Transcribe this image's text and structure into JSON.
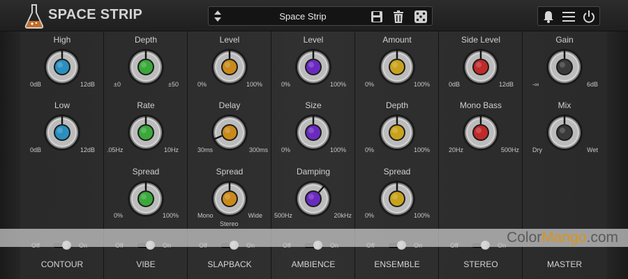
{
  "header": {
    "title": "SPACE STRIP",
    "preset_name": "Space Strip",
    "icons": [
      "flask-logo-icon",
      "up-down-arrows-icon",
      "save-icon",
      "trash-icon",
      "dice-icon",
      "bell-icon",
      "menu-icon",
      "power-icon"
    ]
  },
  "colors": {
    "blue": "#2a8fc0",
    "green": "#3aa83a",
    "orange": "#c98a1a",
    "purple": "#6a2ac0",
    "yellow": "#c8a21a",
    "red": "#c02a2a",
    "gray": "#3a3a3a"
  },
  "columns": [
    {
      "name": "CONTOUR",
      "toggle": {
        "off": "Off",
        "on": "On",
        "value": "on"
      },
      "knobs": [
        {
          "label": "High",
          "min": "0dB",
          "max": "12dB",
          "color": "blue",
          "value": 0.5
        },
        {
          "label": "Low",
          "min": "0dB",
          "max": "12dB",
          "color": "blue",
          "value": 0.5
        }
      ]
    },
    {
      "name": "VIBE",
      "toggle": {
        "off": "Off",
        "on": "On",
        "value": "on"
      },
      "knobs": [
        {
          "label": "Depth",
          "min": "±0",
          "max": "±50",
          "color": "green",
          "value": 0.5
        },
        {
          "label": "Rate",
          "min": ".05Hz",
          "max": "10Hz",
          "color": "green",
          "value": 0.5
        },
        {
          "label": "Spread",
          "min": "0%",
          "max": "100%",
          "color": "green",
          "value": 0.5
        }
      ]
    },
    {
      "name": "SLAPBACK",
      "toggle": {
        "off": "Off",
        "on": "On",
        "value": "on"
      },
      "knobs": [
        {
          "label": "Level",
          "min": "0%",
          "max": "100%",
          "color": "orange",
          "value": 0.5
        },
        {
          "label": "Delay",
          "min": "30ms",
          "max": "300ms",
          "color": "orange",
          "value": 0.08
        },
        {
          "label": "Spread",
          "min": "Mono",
          "max": "Wide",
          "center": "Stereo",
          "color": "orange",
          "value": 0.5
        }
      ]
    },
    {
      "name": "AMBIENCE",
      "toggle": {
        "off": "Off",
        "on": "On",
        "value": "on"
      },
      "knobs": [
        {
          "label": "Level",
          "min": "0%",
          "max": "100%",
          "color": "purple",
          "value": 0.5
        },
        {
          "label": "Size",
          "min": "0%",
          "max": "100%",
          "color": "purple",
          "value": 0.5
        },
        {
          "label": "Damping",
          "min": "500Hz",
          "max": "20kHz",
          "color": "purple",
          "value": 0.65
        }
      ]
    },
    {
      "name": "ENSEMBLE",
      "toggle": {
        "off": "Off",
        "on": "On",
        "value": "on"
      },
      "knobs": [
        {
          "label": "Amount",
          "min": "0%",
          "max": "100%",
          "color": "yellow",
          "value": 0.5
        },
        {
          "label": "Depth",
          "min": "0%",
          "max": "100%",
          "color": "yellow",
          "value": 0.5
        },
        {
          "label": "Spread",
          "min": "0%",
          "max": "100%",
          "color": "yellow",
          "value": 0.5
        }
      ]
    },
    {
      "name": "STEREO",
      "toggle": {
        "off": "Off",
        "on": "On",
        "value": "on"
      },
      "knobs": [
        {
          "label": "Side Level",
          "min": "0dB",
          "max": "12dB",
          "color": "red",
          "value": 0.5
        },
        {
          "label": "Mono Bass",
          "min": "20Hz",
          "max": "500Hz",
          "color": "red",
          "value": 0.5
        }
      ]
    },
    {
      "name": "MASTER",
      "knobs": [
        {
          "label": "Gain",
          "min": "-∞",
          "max": "6dB",
          "color": "gray",
          "value": 0.5
        },
        {
          "label": "Mix",
          "min": "Dry",
          "max": "Wet",
          "color": "gray",
          "value": 0.5
        }
      ]
    }
  ],
  "watermark": {
    "part1": "Color",
    "part2": "Mango",
    "part3": ".com"
  }
}
